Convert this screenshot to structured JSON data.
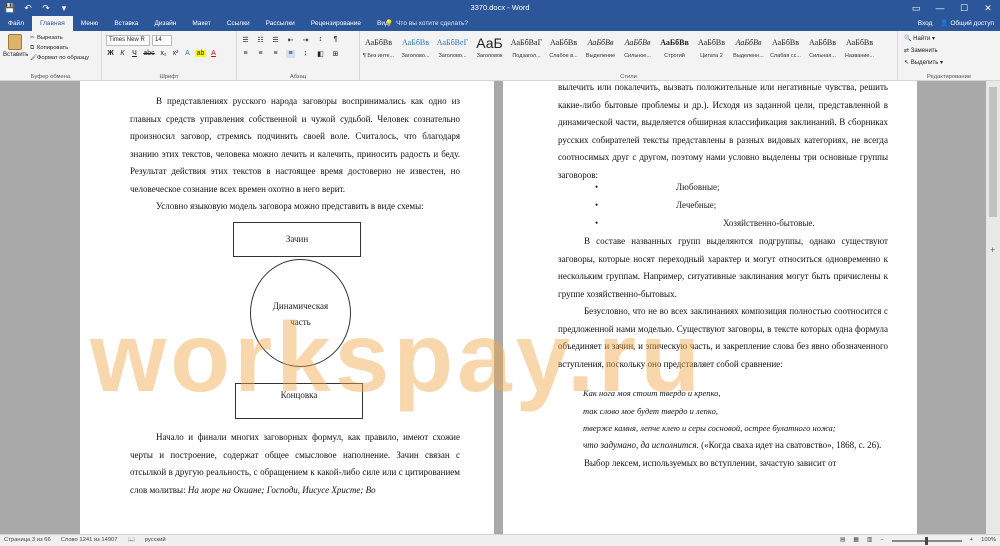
{
  "window": {
    "title": "3370.docx - Word",
    "qat": [
      "💾",
      "↶",
      "↷",
      "▾"
    ],
    "controls": [
      "▭",
      "—",
      "☐",
      "✕"
    ]
  },
  "tabs": {
    "file": "Файл",
    "items": [
      "Главная",
      "Меню",
      "Вставка",
      "Дизайн",
      "Макет",
      "Ссылки",
      "Рассылки",
      "Рецензирование",
      "Вид"
    ],
    "tellme": "Что вы хотите сделать?",
    "signin": "Вход",
    "share": "Общий доступ"
  },
  "ribbon": {
    "clipboard": {
      "paste": "Вставить",
      "cut": "Вырезать",
      "copy": "Копировать",
      "format_painter": "Формат по образцу",
      "label": "Буфер обмена"
    },
    "font": {
      "name": "Times New R",
      "size": "14",
      "label": "Шрифт",
      "row2": [
        "Ж",
        "К",
        "Ч",
        "abc",
        "x₂",
        "x²",
        "A",
        "ab",
        "A"
      ]
    },
    "paragraph": {
      "label": "Абзац",
      "row1": [
        "☰",
        "☷",
        "☰",
        "⇤",
        "⇥",
        "↕",
        "¶"
      ],
      "row2": [
        "≡",
        "≡",
        "≡",
        "≡",
        "↨",
        "◧",
        "⊞"
      ]
    },
    "styles": {
      "label": "Стили",
      "items": [
        {
          "sample": "АаБбВв",
          "name": "¶ Без инте..."
        },
        {
          "sample": "АаБбВв",
          "name": "Заголово..."
        },
        {
          "sample": "АаБбВеГ",
          "name": "Заголово..."
        },
        {
          "sample": "АаБ",
          "name": "Заголовок"
        },
        {
          "sample": "АаБбВаГ",
          "name": "Подзагол..."
        },
        {
          "sample": "АаБбВв",
          "name": "Слабое в..."
        },
        {
          "sample": "АаБбВв",
          "name": "Выделение"
        },
        {
          "sample": "АаБбВв",
          "name": "Сильное..."
        },
        {
          "sample": "АаБбВв",
          "name": "Строгий"
        },
        {
          "sample": "АаБбВв",
          "name": "Цитата 2"
        },
        {
          "sample": "АаБбВв",
          "name": "Выделенн..."
        },
        {
          "sample": "АаБбВв",
          "name": "Слабая сс..."
        },
        {
          "sample": "АаБбВв",
          "name": "Сильная..."
        },
        {
          "sample": "АаБбВв",
          "name": "Название..."
        }
      ]
    },
    "editing": {
      "label": "Редактирование",
      "find": "Найти",
      "replace": "Заменить",
      "select": "Выделить"
    }
  },
  "left_page": {
    "para1": "В представлениях русского народа заговоры воспринимались как одно из главных средств управления собственной и чужой судьбой. Человек сознательно произносил заговор, стремясь подчинить своей воле. Считалось, что благодаря знанию этих текстов, человека можно лечить и калечить, приносить радость и беду. Результат действия этих текстов в настоящее время достоверно не известен, но человеческое сознание всех времен охотно в него верит.",
    "para2": "Условно языковую модель заговора можно представить в виде схемы:",
    "diagram": {
      "top": "Зачин",
      "middle_line1": "Динамическая",
      "middle_line2": "часть",
      "bottom": "Концовка"
    },
    "para3": "Начало и финали многих заговорных формул, как правило, имеют схожие черты и построение, содержат общее смысловое наполнение. Зачин связан с отсылкой в другую реальность, с обращением к какой-либо силе или с цитированием слов молитвы:",
    "para3_italic": "На море на Окиане; Господи, Иисусе Христе; Во"
  },
  "right_page": {
    "para1": "вылечить или покалечить, вызвать положительные или негативные чувства, решить какие-либо бытовые проблемы и др.). Исходя из заданной цели, представленной в динамической части, выделяется обширная классификация заклинаний. В сборниках русских собирателей тексты представлены в разных видовых категориях, не всегда соотносимых друг с другом, поэтому нами условно выделены три основные группы заговоров:",
    "bullets": [
      "Любовные;",
      "Лечебные;",
      "Хозяйственно-бытовые."
    ],
    "para2": "В составе названных групп выделяются подгруппы, однако существуют заговоры, которые носят переходный характер и могут относиться одновременно к нескольким группам. Например, ситуативные заклинания могут быть причислены к группе хозяйственно-бытовых.",
    "para3": "Безусловно, что не во всех заклинаниях композиция полностью соотносится с предложенной нами моделью. Существуют заговоры, в тексте которых одна формула объединяет и зачин, и эпическую часть, и закрепление слова без явно обозначенного вступления, поскольку оно представляет собой сравнение:",
    "poem": [
      "Как нога моя стоит твердо и крепко,",
      "так слово мое будет твердо и лепко,",
      "тверже камня, лепче клею и серы сосновой, острее булатного ножа;",
      "что задумано, да исполнится."
    ],
    "citation": " («Когда сваха идет на сватовство», 1868, с. 26).",
    "para4": "Выбор лексем, используемых во вступлении, зачастую зависит от"
  },
  "watermark": "workspay.ru",
  "status": {
    "page": "Страница 3 из 66",
    "words": "Слово 1241 из 14907",
    "lang": "русский",
    "zoom": "100%"
  }
}
